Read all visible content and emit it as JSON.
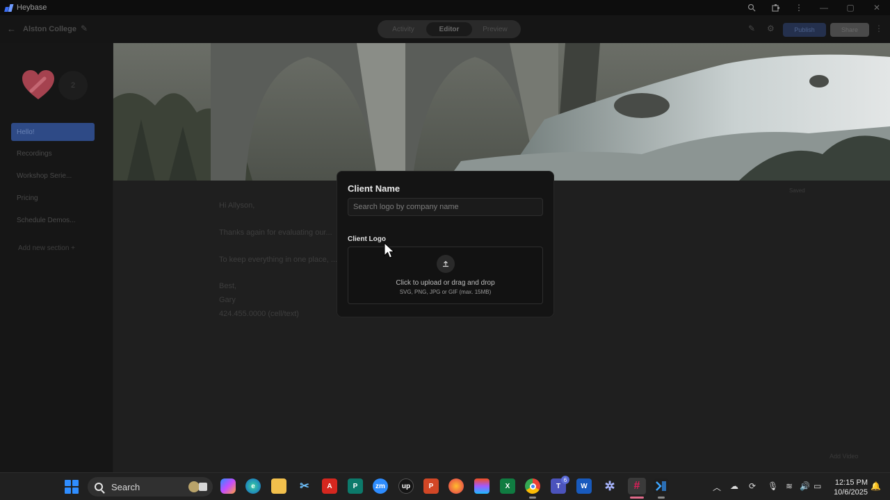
{
  "window": {
    "app_name": "Heybase",
    "controls": {
      "minimize": "—",
      "maximize": "▢",
      "close": "✕"
    }
  },
  "header": {
    "site_name": "Alston College",
    "tabs": [
      {
        "label": "Activity"
      },
      {
        "label": "Editor"
      },
      {
        "label": "Preview"
      }
    ],
    "active_tab": "Editor",
    "publish_label": "Publish",
    "share_label": "Share"
  },
  "sidebar": {
    "avatar_count": "2",
    "items": [
      {
        "label": "Hello!"
      },
      {
        "label": "Recordings"
      },
      {
        "label": "Workshop Serie..."
      },
      {
        "label": "Pricing"
      },
      {
        "label": "Schedule Demos..."
      }
    ],
    "add_section_label": "Add new section +"
  },
  "content": {
    "saved_label": "Saved",
    "letter": [
      "Hi Allyson,",
      "Thanks again for evaluating our...",
      "To keep everything in one place, ... uploaded on this site.",
      "Best,",
      "Gary",
      "424.455.0000 (cell/text)"
    ],
    "add_video_label": "Add Video"
  },
  "modal": {
    "title": "Client Name",
    "search_placeholder": "Search logo by company name",
    "search_value": "",
    "logo_label": "Client Logo",
    "upload_main": "Click to upload or drag and drop",
    "upload_sub": "SVG, PNG, JPG or GIF (max. 15MB)"
  },
  "taskbar": {
    "search_label": "Search",
    "apps": [
      {
        "name": "copilot",
        "glyph": ""
      },
      {
        "name": "edge",
        "glyph": "e"
      },
      {
        "name": "file-explorer",
        "glyph": ""
      },
      {
        "name": "snipping-tool",
        "glyph": "✂"
      },
      {
        "name": "acrobat",
        "glyph": "A"
      },
      {
        "name": "publisher",
        "glyph": "P"
      },
      {
        "name": "zoom",
        "glyph": "zm"
      },
      {
        "name": "upwork",
        "glyph": "up"
      },
      {
        "name": "powerpoint",
        "glyph": "P"
      },
      {
        "name": "firefox",
        "glyph": ""
      },
      {
        "name": "figma",
        "glyph": ""
      },
      {
        "name": "excel",
        "glyph": "X"
      },
      {
        "name": "chrome",
        "glyph": ""
      },
      {
        "name": "teams",
        "glyph": "T",
        "badge": "6"
      },
      {
        "name": "word",
        "glyph": "W"
      },
      {
        "name": "settings-gear",
        "glyph": "✲"
      },
      {
        "name": "slack",
        "glyph": "#"
      },
      {
        "name": "vscode-terminal",
        "glyph": ""
      }
    ],
    "time": "12:15 PM",
    "date": "10/6/2025"
  }
}
